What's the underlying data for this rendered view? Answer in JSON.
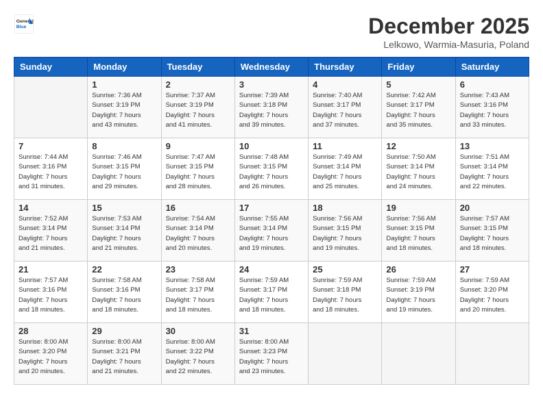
{
  "header": {
    "logo": {
      "general": "General",
      "blue": "Blue"
    },
    "title": "December 2025",
    "location": "Lelkowo, Warmia-Masuria, Poland"
  },
  "days_of_week": [
    "Sunday",
    "Monday",
    "Tuesday",
    "Wednesday",
    "Thursday",
    "Friday",
    "Saturday"
  ],
  "weeks": [
    [
      {
        "day": "",
        "info": ""
      },
      {
        "day": "1",
        "info": "Sunrise: 7:36 AM\nSunset: 3:19 PM\nDaylight: 7 hours\nand 43 minutes."
      },
      {
        "day": "2",
        "info": "Sunrise: 7:37 AM\nSunset: 3:19 PM\nDaylight: 7 hours\nand 41 minutes."
      },
      {
        "day": "3",
        "info": "Sunrise: 7:39 AM\nSunset: 3:18 PM\nDaylight: 7 hours\nand 39 minutes."
      },
      {
        "day": "4",
        "info": "Sunrise: 7:40 AM\nSunset: 3:17 PM\nDaylight: 7 hours\nand 37 minutes."
      },
      {
        "day": "5",
        "info": "Sunrise: 7:42 AM\nSunset: 3:17 PM\nDaylight: 7 hours\nand 35 minutes."
      },
      {
        "day": "6",
        "info": "Sunrise: 7:43 AM\nSunset: 3:16 PM\nDaylight: 7 hours\nand 33 minutes."
      }
    ],
    [
      {
        "day": "7",
        "info": "Sunrise: 7:44 AM\nSunset: 3:16 PM\nDaylight: 7 hours\nand 31 minutes."
      },
      {
        "day": "8",
        "info": "Sunrise: 7:46 AM\nSunset: 3:15 PM\nDaylight: 7 hours\nand 29 minutes."
      },
      {
        "day": "9",
        "info": "Sunrise: 7:47 AM\nSunset: 3:15 PM\nDaylight: 7 hours\nand 28 minutes."
      },
      {
        "day": "10",
        "info": "Sunrise: 7:48 AM\nSunset: 3:15 PM\nDaylight: 7 hours\nand 26 minutes."
      },
      {
        "day": "11",
        "info": "Sunrise: 7:49 AM\nSunset: 3:14 PM\nDaylight: 7 hours\nand 25 minutes."
      },
      {
        "day": "12",
        "info": "Sunrise: 7:50 AM\nSunset: 3:14 PM\nDaylight: 7 hours\nand 24 minutes."
      },
      {
        "day": "13",
        "info": "Sunrise: 7:51 AM\nSunset: 3:14 PM\nDaylight: 7 hours\nand 22 minutes."
      }
    ],
    [
      {
        "day": "14",
        "info": "Sunrise: 7:52 AM\nSunset: 3:14 PM\nDaylight: 7 hours\nand 21 minutes."
      },
      {
        "day": "15",
        "info": "Sunrise: 7:53 AM\nSunset: 3:14 PM\nDaylight: 7 hours\nand 21 minutes."
      },
      {
        "day": "16",
        "info": "Sunrise: 7:54 AM\nSunset: 3:14 PM\nDaylight: 7 hours\nand 20 minutes."
      },
      {
        "day": "17",
        "info": "Sunrise: 7:55 AM\nSunset: 3:14 PM\nDaylight: 7 hours\nand 19 minutes."
      },
      {
        "day": "18",
        "info": "Sunrise: 7:56 AM\nSunset: 3:15 PM\nDaylight: 7 hours\nand 19 minutes."
      },
      {
        "day": "19",
        "info": "Sunrise: 7:56 AM\nSunset: 3:15 PM\nDaylight: 7 hours\nand 18 minutes."
      },
      {
        "day": "20",
        "info": "Sunrise: 7:57 AM\nSunset: 3:15 PM\nDaylight: 7 hours\nand 18 minutes."
      }
    ],
    [
      {
        "day": "21",
        "info": "Sunrise: 7:57 AM\nSunset: 3:16 PM\nDaylight: 7 hours\nand 18 minutes."
      },
      {
        "day": "22",
        "info": "Sunrise: 7:58 AM\nSunset: 3:16 PM\nDaylight: 7 hours\nand 18 minutes."
      },
      {
        "day": "23",
        "info": "Sunrise: 7:58 AM\nSunset: 3:17 PM\nDaylight: 7 hours\nand 18 minutes."
      },
      {
        "day": "24",
        "info": "Sunrise: 7:59 AM\nSunset: 3:17 PM\nDaylight: 7 hours\nand 18 minutes."
      },
      {
        "day": "25",
        "info": "Sunrise: 7:59 AM\nSunset: 3:18 PM\nDaylight: 7 hours\nand 18 minutes."
      },
      {
        "day": "26",
        "info": "Sunrise: 7:59 AM\nSunset: 3:19 PM\nDaylight: 7 hours\nand 19 minutes."
      },
      {
        "day": "27",
        "info": "Sunrise: 7:59 AM\nSunset: 3:20 PM\nDaylight: 7 hours\nand 20 minutes."
      }
    ],
    [
      {
        "day": "28",
        "info": "Sunrise: 8:00 AM\nSunset: 3:20 PM\nDaylight: 7 hours\nand 20 minutes."
      },
      {
        "day": "29",
        "info": "Sunrise: 8:00 AM\nSunset: 3:21 PM\nDaylight: 7 hours\nand 21 minutes."
      },
      {
        "day": "30",
        "info": "Sunrise: 8:00 AM\nSunset: 3:22 PM\nDaylight: 7 hours\nand 22 minutes."
      },
      {
        "day": "31",
        "info": "Sunrise: 8:00 AM\nSunset: 3:23 PM\nDaylight: 7 hours\nand 23 minutes."
      },
      {
        "day": "",
        "info": ""
      },
      {
        "day": "",
        "info": ""
      },
      {
        "day": "",
        "info": ""
      }
    ]
  ]
}
